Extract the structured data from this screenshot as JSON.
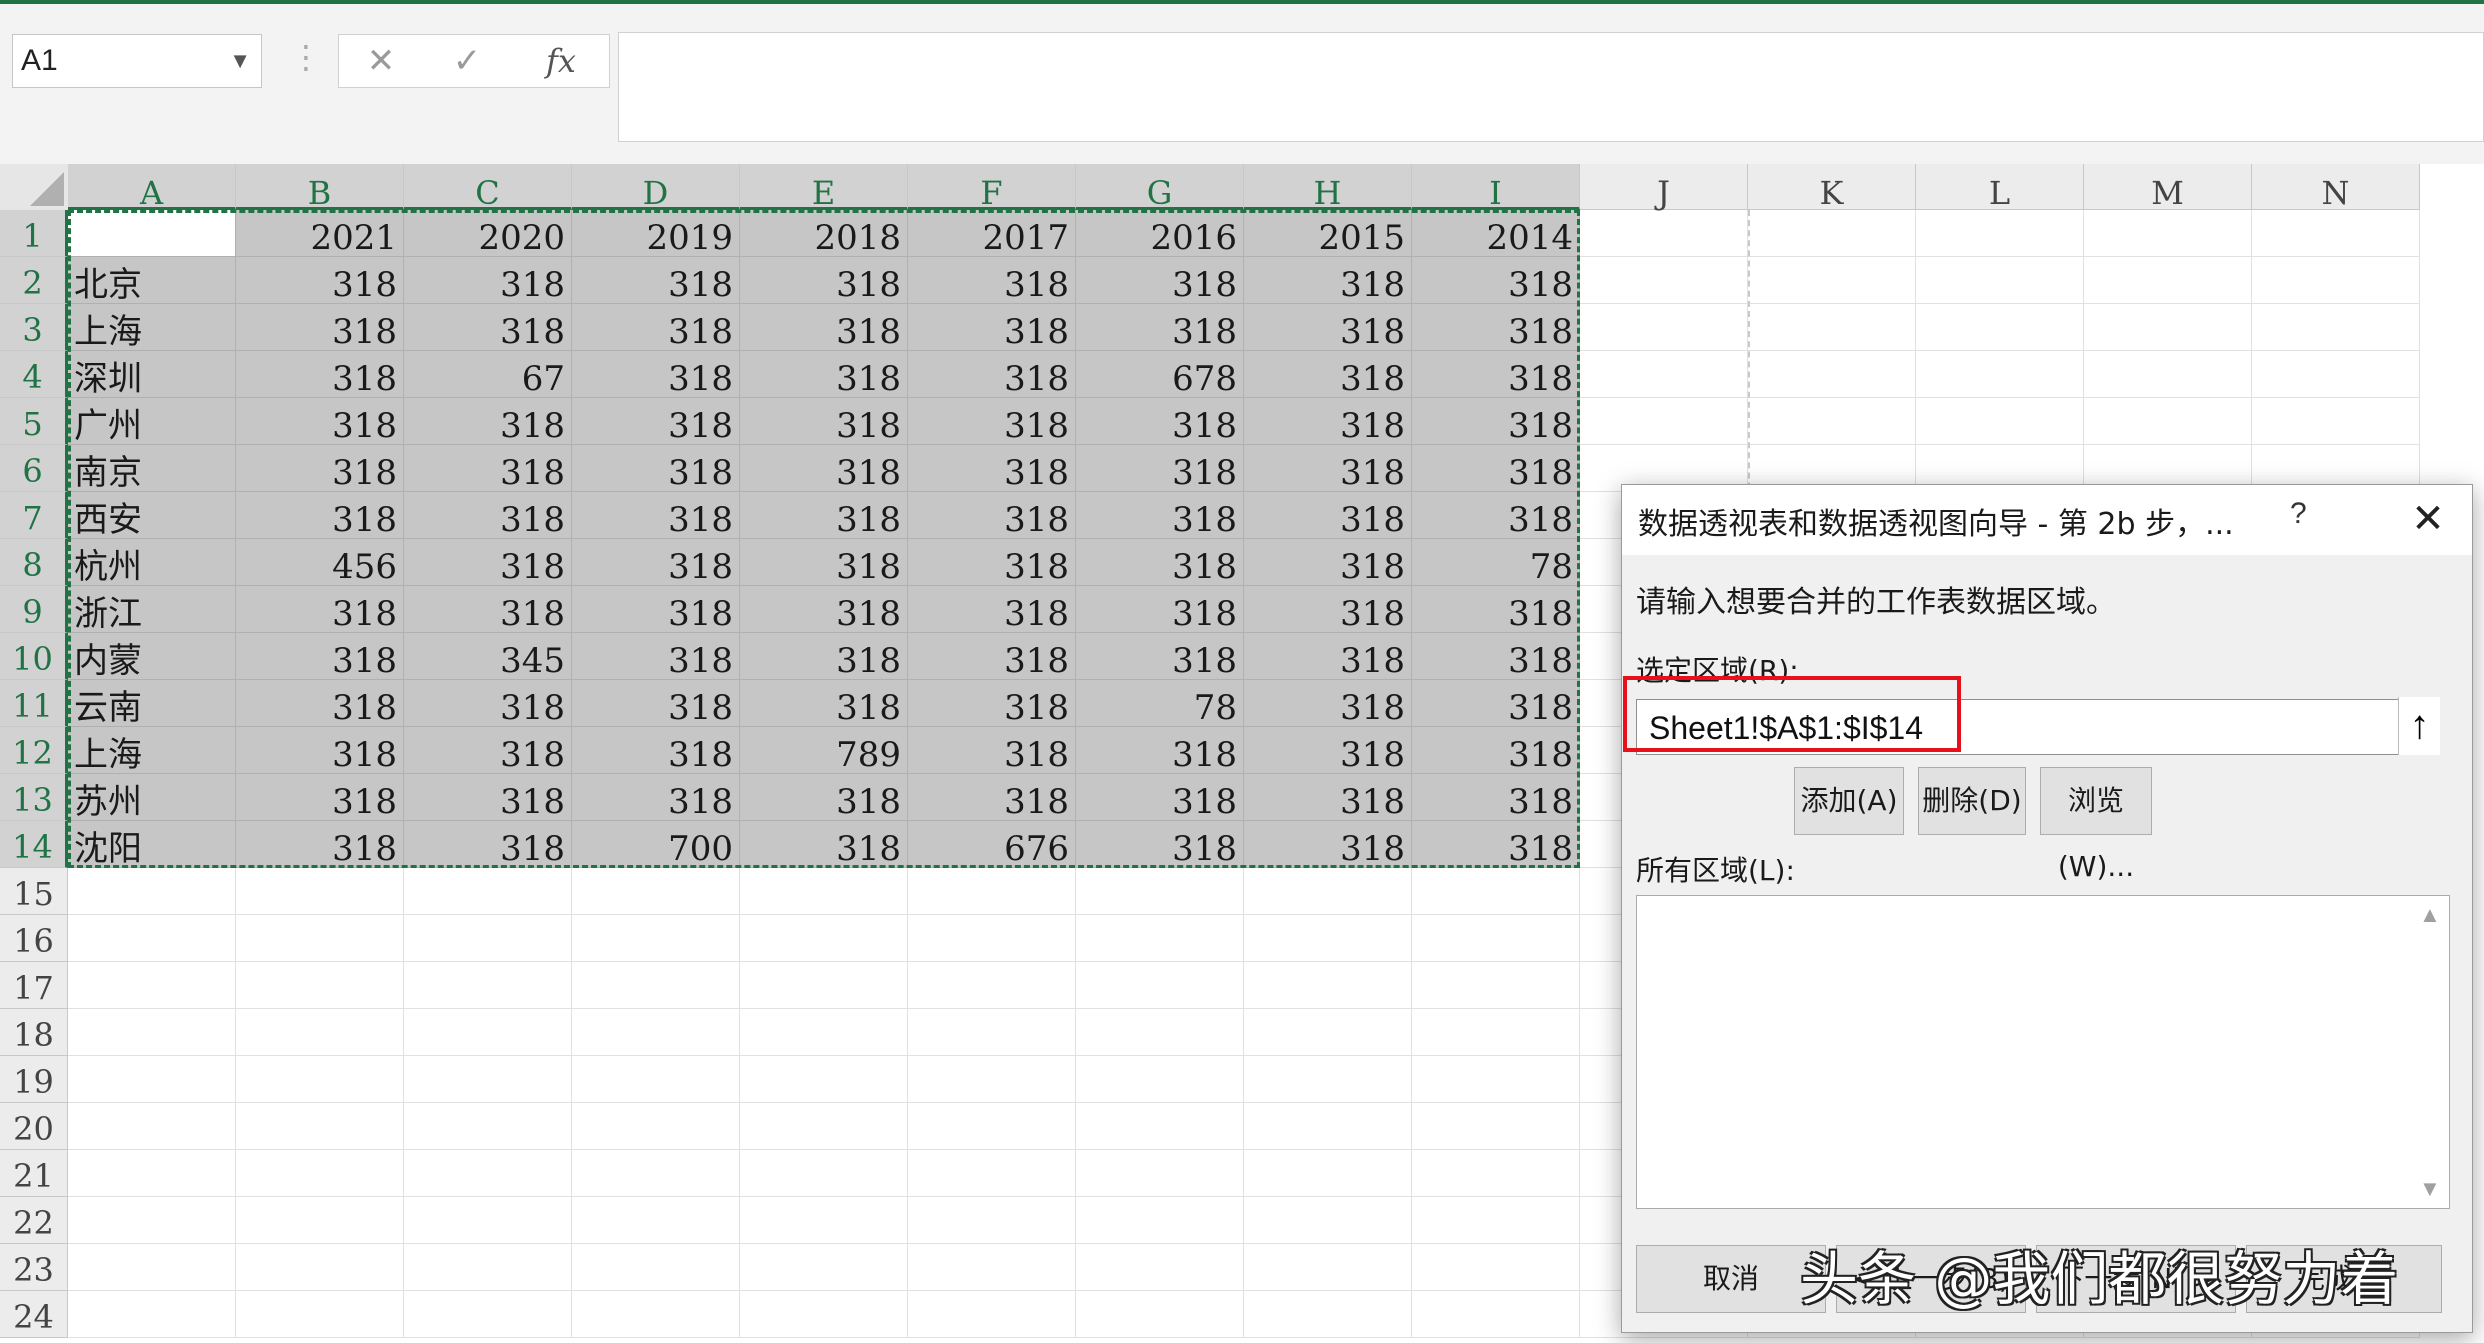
{
  "formula_bar": {
    "name_box": "A1",
    "cancel_icon": "✕",
    "confirm_icon": "✓",
    "fx_label": "fx",
    "formula_value": ""
  },
  "columns": [
    "A",
    "B",
    "C",
    "D",
    "E",
    "F",
    "G",
    "H",
    "I",
    "J",
    "K",
    "L",
    "M",
    "N"
  ],
  "rows": [
    "1",
    "2",
    "3",
    "4",
    "5",
    "6",
    "7",
    "8",
    "9",
    "10",
    "11",
    "12",
    "13",
    "14",
    "15",
    "16",
    "17",
    "18",
    "19",
    "20",
    "21",
    "22",
    "23",
    "24"
  ],
  "sheet": {
    "header_row": [
      "",
      "2021",
      "2020",
      "2019",
      "2018",
      "2017",
      "2016",
      "2015",
      "2014"
    ],
    "data": [
      [
        "北京",
        "318",
        "318",
        "318",
        "318",
        "318",
        "318",
        "318",
        "318"
      ],
      [
        "上海",
        "318",
        "318",
        "318",
        "318",
        "318",
        "318",
        "318",
        "318"
      ],
      [
        "深圳",
        "318",
        "67",
        "318",
        "318",
        "318",
        "678",
        "318",
        "318"
      ],
      [
        "广州",
        "318",
        "318",
        "318",
        "318",
        "318",
        "318",
        "318",
        "318"
      ],
      [
        "南京",
        "318",
        "318",
        "318",
        "318",
        "318",
        "318",
        "318",
        "318"
      ],
      [
        "西安",
        "318",
        "318",
        "318",
        "318",
        "318",
        "318",
        "318",
        "318"
      ],
      [
        "杭州",
        "456",
        "318",
        "318",
        "318",
        "318",
        "318",
        "318",
        "78"
      ],
      [
        "浙江",
        "318",
        "318",
        "318",
        "318",
        "318",
        "318",
        "318",
        "318"
      ],
      [
        "内蒙",
        "318",
        "345",
        "318",
        "318",
        "318",
        "318",
        "318",
        "318"
      ],
      [
        "云南",
        "318",
        "318",
        "318",
        "318",
        "318",
        "78",
        "318",
        "318"
      ],
      [
        "上海",
        "318",
        "318",
        "318",
        "789",
        "318",
        "318",
        "318",
        "318"
      ],
      [
        "苏州",
        "318",
        "318",
        "318",
        "318",
        "318",
        "318",
        "318",
        "318"
      ],
      [
        "沈阳",
        "318",
        "318",
        "700",
        "318",
        "676",
        "318",
        "318",
        "318"
      ]
    ]
  },
  "dialog": {
    "title": "数据透视表和数据透视图向导 - 第 2b 步，...",
    "help": "?",
    "close": "✕",
    "instruction": "请输入想要合并的工作表数据区域。",
    "range_label": "选定区域(R):",
    "range_value": "Sheet1!$A$1:$I$14",
    "collapse_icon": "↑",
    "add_button": "添加(A)",
    "delete_button": "删除(D)",
    "browse_button": "浏览(W)...",
    "all_ranges_label": "所有区域(L):",
    "cancel_button": "取消",
    "back_button": "< 上一步(B)",
    "next_button": "下一步(N) >",
    "finish_button": "完成(F)"
  },
  "watermark": "头条 @我们都很努力着",
  "colors": {
    "accent": "#217346",
    "selection_fill": "#c6c6c6",
    "highlight_red": "#e8101a"
  }
}
